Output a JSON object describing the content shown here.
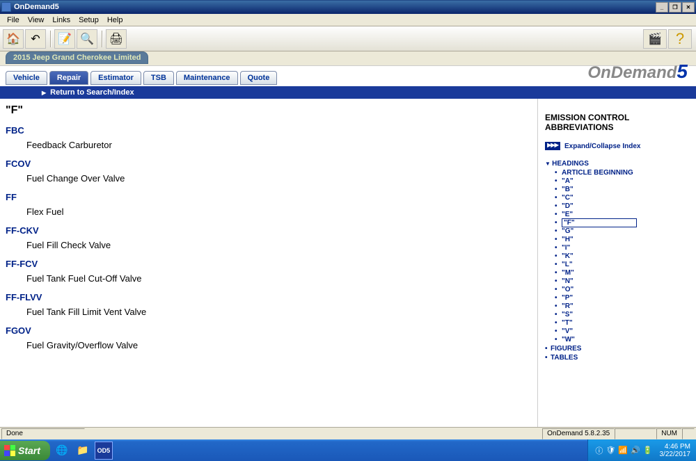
{
  "window": {
    "title": "OnDemand5"
  },
  "menu": {
    "file": "File",
    "view": "View",
    "links": "Links",
    "setup": "Setup",
    "help": "Help"
  },
  "vehicle_tab": "2015 Jeep Grand Cherokee Limited",
  "tabs": {
    "vehicle": "Vehicle",
    "repair": "Repair",
    "estimator": "Estimator",
    "tsb": "TSB",
    "maintenance": "Maintenance",
    "quote": "Quote"
  },
  "logo": {
    "text": "OnDemand",
    "suffix": "5"
  },
  "return_bar": "Return to Search/Index",
  "article": {
    "heading": "\"F\"",
    "entries": [
      {
        "abbr": "FBC",
        "def": "Feedback Carburetor"
      },
      {
        "abbr": "FCOV",
        "def": "Fuel Change Over Valve"
      },
      {
        "abbr": "FF",
        "def": "Flex Fuel"
      },
      {
        "abbr": "FF-CKV",
        "def": "Fuel Fill Check Valve"
      },
      {
        "abbr": "FF-FCV",
        "def": "Fuel Tank Fuel Cut-Off Valve"
      },
      {
        "abbr": "FF-FLVV",
        "def": "Fuel Tank Fill Limit Vent Valve"
      },
      {
        "abbr": "FGOV",
        "def": "Fuel Gravity/Overflow Valve"
      }
    ]
  },
  "side": {
    "title": "EMISSION CONTROL ABBREVIATIONS",
    "expand": "Expand/Collapse Index",
    "headings_label": "HEADINGS",
    "article_begin": "ARTICLE BEGINNING",
    "letters": [
      "\"A\"",
      "\"B\"",
      "\"C\"",
      "\"D\"",
      "\"E\"",
      "\"F\"",
      "\"G\"",
      "\"H\"",
      "\"I\"",
      "\"K\"",
      "\"L\"",
      "\"M\"",
      "\"N\"",
      "\"O\"",
      "\"P\"",
      "\"R\"",
      "\"S\"",
      "\"T\"",
      "\"V\"",
      "\"W\""
    ],
    "selected": "\"F\"",
    "figures": "FIGURES",
    "tables": "TABLES"
  },
  "status": {
    "done": "Done",
    "product": "OnDemand 5.8.2.35",
    "num": "NUM"
  },
  "taskbar": {
    "start": "Start",
    "od5": "OD5",
    "time": "4:46 PM",
    "date": "3/22/2017"
  }
}
